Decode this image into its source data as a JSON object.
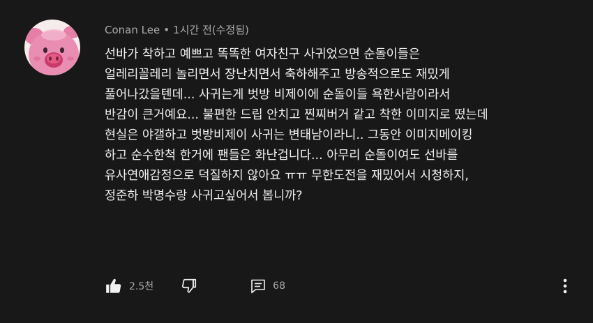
{
  "comment": {
    "author": "Conan Lee",
    "separator": "•",
    "timestamp": "1시간 전(수정됨)",
    "lines": [
      "선바가 착하고 예쁘고 똑똑한 여자친구 사귀었으면 순돌이들은",
      "얼레리꼴레리 놀리면서 장난치면서 축하해주고 방송적으로도 재밌게",
      "풀어나갔을텐데... 사귀는게 벗방 비제이에 순돌이들 욕한사람이라서",
      "반감이 큰거예요... 불편한 드립 안치고 찐찌버거 같고 착한 이미지로 떴는데",
      "현실은 야갤하고 벗방비제이 사귀는 변태남이라니.. 그동안 이미지메이킹",
      "하고 순수한척 한거에 팬들은 화난겁니다... 아무리 순돌이여도 선바를",
      "유사연애감정으로 덕질하지 않아요 ㅠㅠ 무한도전을 재밌어서 시청하지,",
      "정준하 박명수랑 사귀고싶어서 봅니까?"
    ],
    "like_count": "2.5천",
    "reply_count": "68"
  },
  "icons": {
    "like": "thumbs-up-icon",
    "dislike": "thumbs-down-icon",
    "reply": "reply-comment-icon",
    "menu": "vertical-dots-menu-icon",
    "avatar": "pink-pig-character-avatar"
  },
  "colors": {
    "background": "#181818",
    "text": "#f1f1f1",
    "secondary_text": "#aaaaaa",
    "avatar_pink": "#e98bb0"
  }
}
